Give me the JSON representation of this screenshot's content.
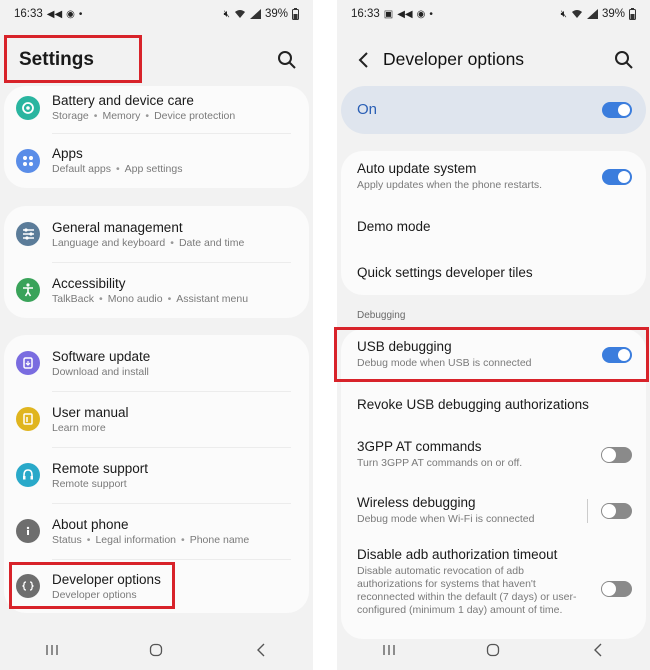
{
  "left": {
    "status": {
      "time": "16:33",
      "battery": "39%"
    },
    "header": {
      "title": "Settings"
    },
    "groups": [
      {
        "items": [
          {
            "title": "Battery and device care",
            "subtitle": [
              "Storage",
              "Memory",
              "Device protection"
            ],
            "icon": "battery-care-icon",
            "color": "#2ab5a0"
          },
          {
            "title": "Apps",
            "subtitle": [
              "Default apps",
              "App settings"
            ],
            "icon": "apps-icon",
            "color": "#5a8de8"
          }
        ]
      },
      {
        "items": [
          {
            "title": "General management",
            "subtitle": [
              "Language and keyboard",
              "Date and time"
            ],
            "icon": "general-management-icon",
            "color": "#5b7c99"
          },
          {
            "title": "Accessibility",
            "subtitle": [
              "TalkBack",
              "Mono audio",
              "Assistant menu"
            ],
            "icon": "accessibility-icon",
            "color": "#3aa35a"
          }
        ]
      },
      {
        "items": [
          {
            "title": "Software update",
            "subtitle": [
              "Download and install"
            ],
            "icon": "software-update-icon",
            "color": "#7a6ce0"
          },
          {
            "title": "User manual",
            "subtitle": [
              "Learn more"
            ],
            "icon": "user-manual-icon",
            "color": "#e0b51f"
          },
          {
            "title": "Remote support",
            "subtitle": [
              "Remote support"
            ],
            "icon": "remote-support-icon",
            "color": "#29a9c9"
          },
          {
            "title": "About phone",
            "subtitle": [
              "Status",
              "Legal information",
              "Phone name"
            ],
            "icon": "about-phone-icon",
            "color": "#6e6e6e"
          },
          {
            "title": "Developer options",
            "subtitle": [
              "Developer options"
            ],
            "icon": "developer-options-icon",
            "color": "#6e6e6e"
          }
        ]
      }
    ]
  },
  "right": {
    "status": {
      "time": "16:33",
      "battery": "39%"
    },
    "header": {
      "title": "Developer options"
    },
    "master": {
      "label": "On",
      "state": "on"
    },
    "group1": [
      {
        "title": "Auto update system",
        "subtitle": "Apply updates when the phone restarts.",
        "toggle": "on"
      },
      {
        "title": "Demo mode",
        "subtitle": ""
      },
      {
        "title": "Quick settings developer tiles",
        "subtitle": ""
      }
    ],
    "section": "Debugging",
    "group2": [
      {
        "title": "USB debugging",
        "subtitle": "Debug mode when USB is connected",
        "toggle": "on"
      },
      {
        "title": "Revoke USB debugging authorizations",
        "subtitle": ""
      },
      {
        "title": "3GPP AT commands",
        "subtitle": "Turn 3GPP AT commands on or off.",
        "toggle": "off"
      },
      {
        "title": "Wireless debugging",
        "subtitle": "Debug mode when Wi-Fi is connected",
        "toggle": "off"
      },
      {
        "title": "Disable adb authorization timeout",
        "subtitle": "Disable automatic revocation of adb authorizations for systems that haven't reconnected within the default (7 days) or user-configured (minimum 1 day) amount of time.",
        "toggle": "off"
      }
    ]
  },
  "colors": {
    "accent": "#3b7ddd",
    "highlight": "#d8232a",
    "toggle_off": "#8a8a8a"
  }
}
